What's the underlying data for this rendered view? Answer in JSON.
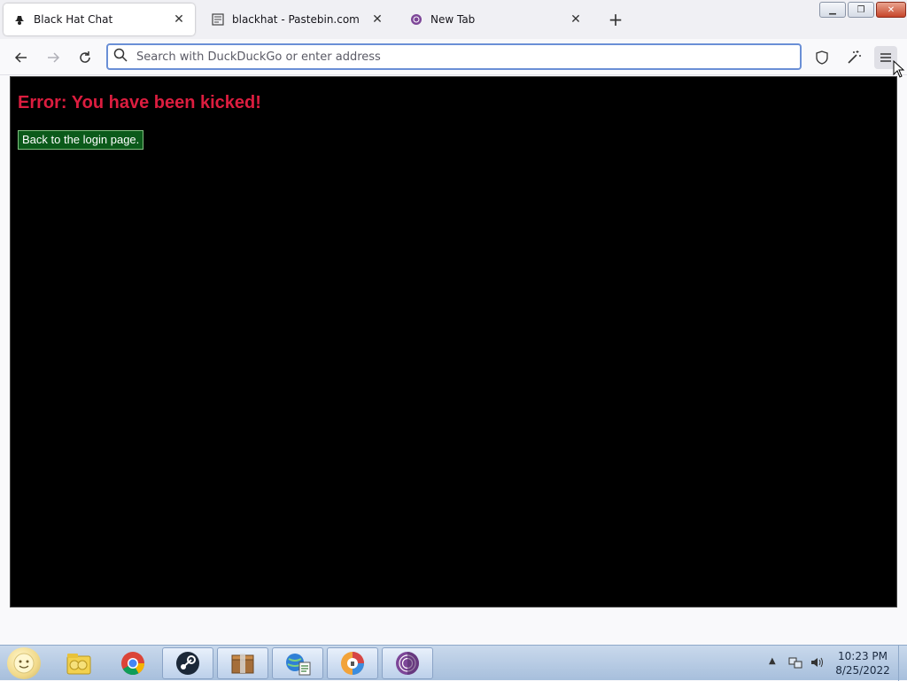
{
  "tabs": [
    {
      "title": "Black Hat Chat",
      "icon": "spy-hat-icon",
      "active": true
    },
    {
      "title": "blackhat - Pastebin.com",
      "icon": "pastebin-icon",
      "active": false
    },
    {
      "title": "New Tab",
      "icon": "tor-browser-icon",
      "active": false
    }
  ],
  "toolbar": {
    "search_placeholder": "Search with DuckDuckGo or enter address"
  },
  "page": {
    "error_heading": "Error: You have been kicked!",
    "login_button": "Back to the login page.",
    "background_color": "#000000",
    "heading_color": "#dc1d3f",
    "button_color": "#0b5a1a"
  },
  "taskbar": {
    "apps": [
      "file-explorer-icon",
      "chrome-icon",
      "steam-icon",
      "archive-icon",
      "network-icon",
      "privacy-browser-icon",
      "tor-browser-icon"
    ],
    "time": "10:23 PM",
    "date": "8/25/2022"
  }
}
